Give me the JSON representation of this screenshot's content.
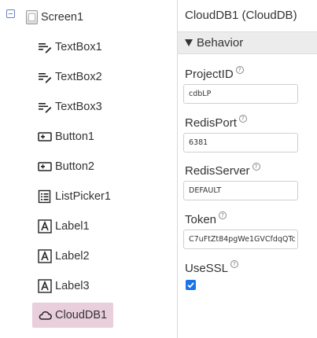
{
  "tree": {
    "screen": "Screen1",
    "items": [
      {
        "label": "TextBox1",
        "icon": "textbox-icon"
      },
      {
        "label": "TextBox2",
        "icon": "textbox-icon"
      },
      {
        "label": "TextBox3",
        "icon": "textbox-icon"
      },
      {
        "label": "Button1",
        "icon": "button-icon"
      },
      {
        "label": "Button2",
        "icon": "button-icon"
      },
      {
        "label": "ListPicker1",
        "icon": "listpicker-icon"
      },
      {
        "label": "Label1",
        "icon": "label-icon"
      },
      {
        "label": "Label2",
        "icon": "label-icon"
      },
      {
        "label": "Label3",
        "icon": "label-icon"
      },
      {
        "label": "CloudDB1",
        "icon": "cloud-icon",
        "selected": true
      }
    ]
  },
  "properties": {
    "title": "CloudDB1 (CloudDB)",
    "section": "Behavior",
    "help_glyph": "?",
    "fields": [
      {
        "name": "ProjectID",
        "value": "cdbLP"
      },
      {
        "name": "RedisPort",
        "value": "6381"
      },
      {
        "name": "RedisServer",
        "value": "DEFAULT"
      },
      {
        "name": "Token",
        "value": "C7uFtZt84pgWe1GVCfdqQTc"
      },
      {
        "name": "UseSSL",
        "checked": true
      }
    ]
  },
  "colors": {
    "selection": "#e8cfdb",
    "checkbox": "#1a73e8",
    "section_bar": "#ececec"
  }
}
